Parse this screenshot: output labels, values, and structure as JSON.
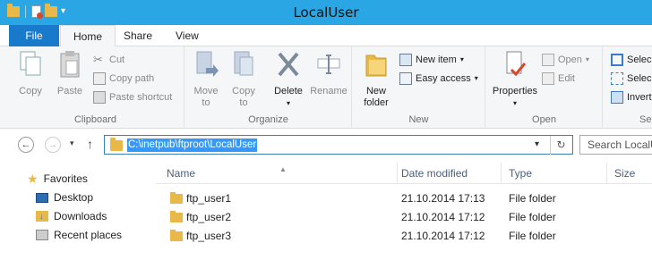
{
  "window": {
    "title": "LocalUser"
  },
  "ribbon_tabs": {
    "file": "File",
    "home": "Home",
    "share": "Share",
    "view": "View"
  },
  "clipboard": {
    "copy": "Copy",
    "paste": "Paste",
    "cut": "Cut",
    "copy_path": "Copy path",
    "paste_shortcut": "Paste shortcut",
    "group_label": "Clipboard"
  },
  "organize": {
    "move_to": "Move",
    "move_to_2": "to",
    "copy_to": "Copy",
    "copy_to_2": "to",
    "delete": "Delete",
    "rename": "Rename",
    "group_label": "Organize"
  },
  "new": {
    "new_folder": "New",
    "new_folder_2": "folder",
    "new_item": "New item",
    "easy_access": "Easy access",
    "group_label": "New"
  },
  "open": {
    "properties": "Properties",
    "open": "Open",
    "edit": "Edit",
    "group_label": "Open"
  },
  "select": {
    "select_all": "Selec",
    "select_none": "Selec",
    "invert": "Invert",
    "group_label": "Se"
  },
  "address": {
    "path": "C:\\inetpub\\ftproot\\LocalUser",
    "search_placeholder": "Search LocalU"
  },
  "nav_pane": {
    "favorites": "Favorites",
    "desktop": "Desktop",
    "downloads": "Downloads",
    "recent": "Recent places"
  },
  "columns": {
    "name": "Name",
    "date": "Date modified",
    "type": "Type",
    "size": "Size"
  },
  "files": [
    {
      "name": "ftp_user1",
      "date": "21.10.2014 17:13",
      "type": "File folder"
    },
    {
      "name": "ftp_user2",
      "date": "21.10.2014 17:12",
      "type": "File folder"
    },
    {
      "name": "ftp_user3",
      "date": "21.10.2014 17:12",
      "type": "File folder"
    }
  ],
  "colors": {
    "titlebar": "#29a6e3",
    "file_tab": "#1979ca",
    "selection": "#3399ff"
  }
}
